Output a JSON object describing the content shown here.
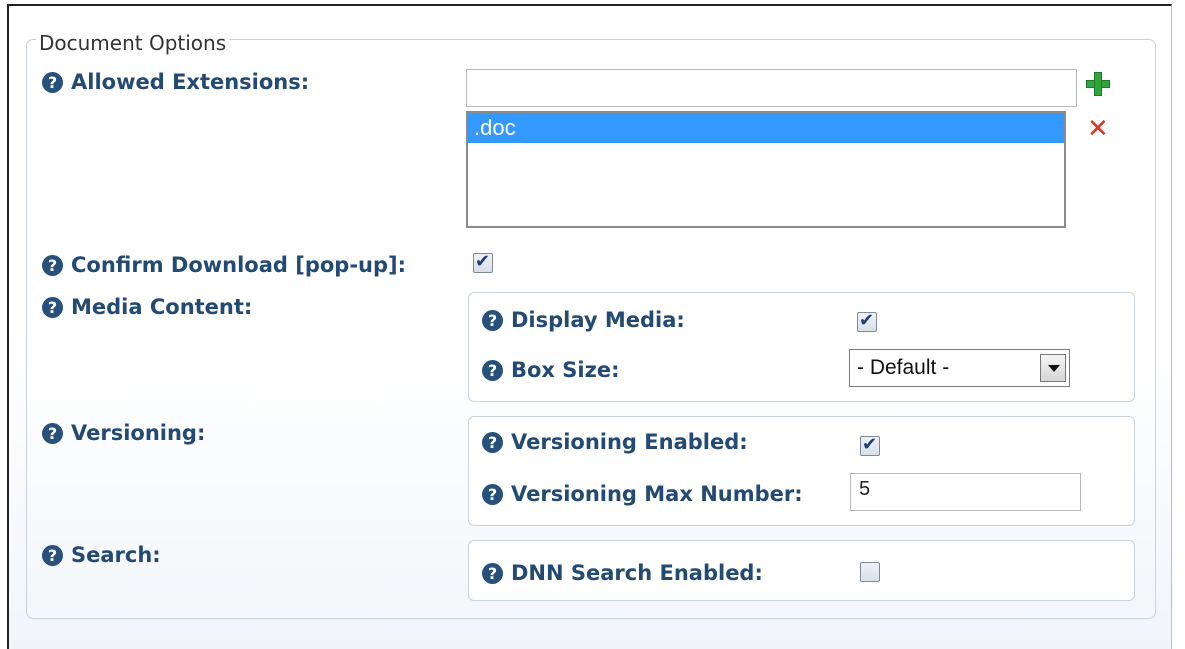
{
  "fieldset_title": "Document Options",
  "allowed_extensions": {
    "label": "Allowed Extensions:",
    "input_value": "",
    "list_items": [
      ".doc"
    ]
  },
  "confirm_download": {
    "label": "Confirm Download [pop-up]:",
    "checked": true
  },
  "media_content": {
    "label": "Media Content:",
    "display_media": {
      "label": "Display Media:",
      "checked": true
    },
    "box_size": {
      "label": "Box Size:",
      "selected": "- Default -"
    }
  },
  "versioning": {
    "label": "Versioning:",
    "enabled": {
      "label": "Versioning Enabled:",
      "checked": true
    },
    "max_number": {
      "label": "Versioning Max Number:",
      "value": "5"
    }
  },
  "search": {
    "label": "Search:",
    "dnn_search": {
      "label": "DNN Search Enabled:",
      "checked": false
    }
  },
  "icons": {
    "help": "help-icon",
    "add": "add-icon",
    "remove": "remove-icon"
  },
  "colors": {
    "label": "#234a73",
    "selection": "#3399ff",
    "add": "#2fa53a",
    "remove": "#e0321c"
  }
}
